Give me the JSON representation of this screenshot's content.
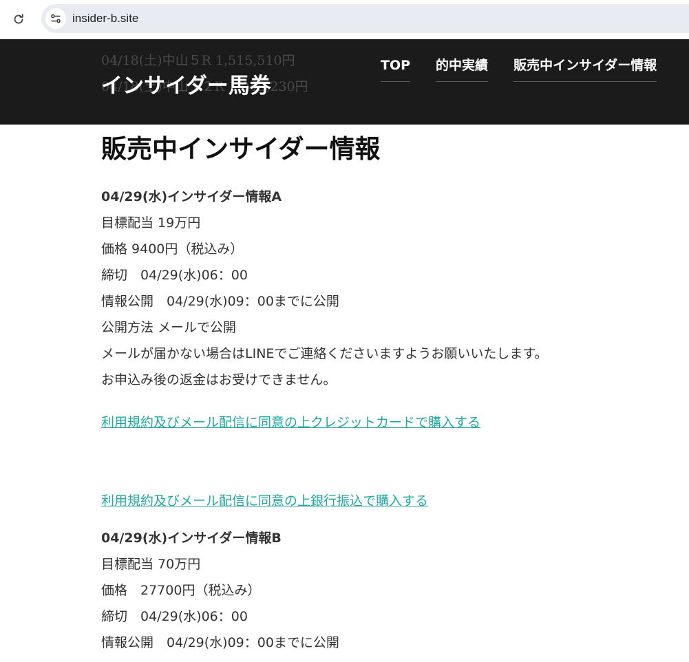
{
  "browser": {
    "url": "insider-b.site"
  },
  "header": {
    "ticker_lines": [
      "04/18(土)中山５R 1,515,510円",
      "04/18(土)中山１２R 1,049,230円"
    ],
    "logo": "インサイダー馬券",
    "nav": [
      {
        "label": "TOP"
      },
      {
        "label": "的中実績"
      },
      {
        "label": "販売中インサイダー情報"
      }
    ]
  },
  "main": {
    "title": "販売中インサイダー情報",
    "products": [
      {
        "title": "04/29(水)インサイダー情報A",
        "lines": [
          "目標配当 19万円",
          "価格 9400円（税込み）",
          "締切　04/29(水)06：00",
          "情報公開　04/29(水)09：00までに公開",
          "公開方法 メールで公開",
          "メールが届かない場合はLINEでご連絡くださいますようお願いいたします。",
          "お申込み後の返金はお受けできません。"
        ],
        "credit_link": "利用規約及びメール配信に同意の上クレジットカードで購入する",
        "bank_link": "利用規約及びメール配信に同意の上銀行振込で購入する"
      },
      {
        "title": "04/29(水)インサイダー情報B",
        "lines": [
          "目標配当 70万円",
          "価格　27700円（税込み）",
          "締切　04/29(水)06：00",
          "情報公開　04/29(水)09：00までに公開"
        ]
      }
    ]
  },
  "colors": {
    "header_bg": "#1b1b1b",
    "link": "#21a8a1",
    "address_bar": "#e9ebf3"
  }
}
